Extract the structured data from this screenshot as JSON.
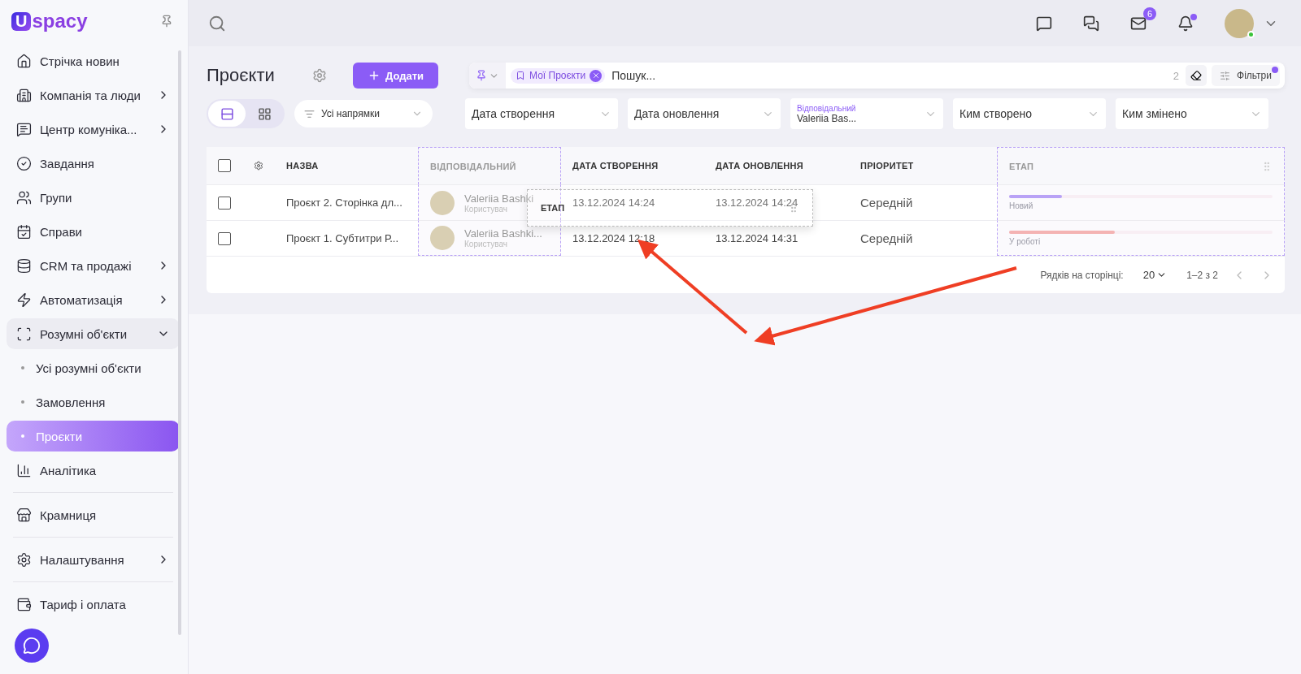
{
  "logo": {
    "letter": "U",
    "text": "spacy"
  },
  "sidebar": {
    "items": [
      {
        "label": "Стрічка новин",
        "kind": "plain",
        "selected": false
      },
      {
        "label": "Компанія та люди",
        "kind": "group",
        "selected": false,
        "expanded": false
      },
      {
        "label": "Центр комуніка...",
        "kind": "group",
        "selected": false,
        "expanded": false
      },
      {
        "label": "Завдання",
        "kind": "plain",
        "selected": false
      },
      {
        "label": "Групи",
        "kind": "plain",
        "selected": false
      },
      {
        "label": "Справи",
        "kind": "plain",
        "selected": false
      },
      {
        "label": "CRM та продажі",
        "kind": "group",
        "selected": false,
        "expanded": false
      },
      {
        "label": "Автоматизація",
        "kind": "group",
        "selected": false,
        "expanded": false
      },
      {
        "label": "Розумні об'єкти",
        "kind": "group",
        "selected": false,
        "expanded": true,
        "children": [
          {
            "label": "Усі розумні об'єкти",
            "selected": false
          },
          {
            "label": "Замовлення",
            "selected": false
          },
          {
            "label": "Проєкти",
            "selected": true
          }
        ]
      },
      {
        "label": "Аналітика",
        "kind": "plain",
        "selected": false
      },
      {
        "label": "Крамниця",
        "kind": "plain",
        "selected": false,
        "divider": true
      },
      {
        "label": "Налаштування",
        "kind": "group",
        "selected": false,
        "expanded": false,
        "divider": true
      },
      {
        "label": "Тариф і оплата",
        "kind": "plain",
        "selected": false,
        "divider": true
      }
    ]
  },
  "topbar": {
    "mail_badge": "6",
    "bell_dot": true,
    "online": true
  },
  "page": {
    "title": "Проєкти",
    "add_button": "Додати"
  },
  "search": {
    "chip": "Мої Проєкти",
    "placeholder": "Пошук...",
    "count": "2",
    "filters_button": "Фільтри",
    "filters_dot": true
  },
  "view_toggle": [
    {
      "kind": "list",
      "selected": true
    },
    {
      "kind": "grid",
      "selected": false
    }
  ],
  "direction_select": "Усі напрямки",
  "filters": [
    {
      "label": "Дата створення"
    },
    {
      "label": "Дата оновлення"
    },
    {
      "label": "Відповідальний",
      "value": "Valeriia Bas..."
    },
    {
      "label": "Ким створено"
    },
    {
      "label": "Ким змінено"
    }
  ],
  "table": {
    "header_checked": false,
    "columns": [
      {
        "label": "НАЗВА",
        "dragging": false
      },
      {
        "label": "ВІДПОВІДАЛЬНИЙ",
        "dragging": true
      },
      {
        "label": "ДАТА СТВОРЕННЯ",
        "dragging": false
      },
      {
        "label": "ДАТА ОНОВЛЕННЯ",
        "dragging": false
      },
      {
        "label": "ПРІОРИТЕТ",
        "dragging": false
      },
      {
        "label": "ЕТАП",
        "dragging": true
      }
    ],
    "rows": [
      {
        "checked": false,
        "name": "Проєкт 2. Сторінка дл...",
        "person": "Valeriia Bashki",
        "role": "Користувач",
        "created": "13.12.2024 14:24",
        "updated": "13.12.2024 14:24",
        "priority": "Середній",
        "stage": {
          "label": "Новий",
          "level": 0.2,
          "color": "#b9a2f6"
        }
      },
      {
        "checked": false,
        "name": "Проєкт 1. Субтитри Р...",
        "person": "Valeriia Bashki...",
        "role": "Користувач",
        "created": "13.12.2024 12:18",
        "updated": "13.12.2024 14:31",
        "priority": "Середній",
        "stage": {
          "label": "У роботі",
          "level": 0.4,
          "color": "#f4b3b3"
        }
      }
    ],
    "drag_ghost": "ЕТАП",
    "footer": {
      "rows_label": "Рядків на сторінці:",
      "rows_value": "20",
      "range": "1–2 з 2"
    }
  }
}
